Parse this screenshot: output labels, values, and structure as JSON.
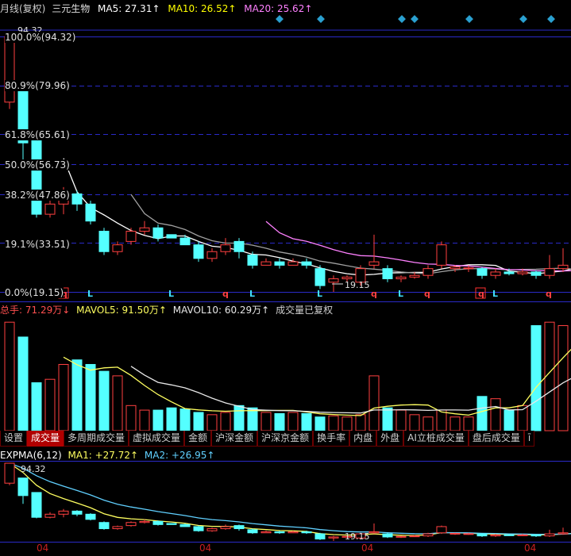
{
  "header": {
    "period": "月线(复权)",
    "stock": "三元生物",
    "ma5_label": "MA5: 27.31↑",
    "ma10_label": "MA10: 26.52↑",
    "ma20_label": "MA20: 25.62↑"
  },
  "price_panel": {
    "high_marker": "94.32",
    "low_marker": "19.15",
    "fib_levels": [
      {
        "label": "100.0%(94.32)",
        "value": 94.32
      },
      {
        "label": "80.9%(79.96)",
        "value": 79.96
      },
      {
        "label": "61.8%(65.61)",
        "value": 65.61
      },
      {
        "label": "50.0%(56.73)",
        "value": 56.73
      },
      {
        "label": "38.2%(47.86)",
        "value": 47.86
      },
      {
        "label": "19.1%(33.51)",
        "value": 33.51
      },
      {
        "label": "0.0%(19.15)",
        "value": 19.15
      }
    ],
    "signals": [
      "q",
      "L",
      "L",
      "q",
      "L",
      "L",
      "q",
      "L",
      "q",
      "q",
      "L",
      "q"
    ],
    "colors": {
      "up": "#ff4040",
      "down": "#54ffff",
      "ma5": "#ffffff",
      "ma10": "#ffff00",
      "ma20": "#ff80ff",
      "grid": "#2a2ac8",
      "diamond": "#2aa0d0"
    }
  },
  "volume_panel": {
    "total_label": "总手: 71.29万↓",
    "mavol5_label": "MAVOL5: 91.50万↑",
    "mavol10_label": "MAVOL10: 60.29万↑",
    "note": "成交量已复权"
  },
  "tabs": [
    "设置",
    "成交量",
    "多周期成交量",
    "虚拟成交量",
    "金额",
    "沪深金额",
    "沪深京金额",
    "换手率",
    "内盘",
    "外盘",
    "AI立桩成交量",
    "盘后成交量",
    "ī"
  ],
  "active_tab": "成交量",
  "expma_panel": {
    "title_label": "EXPMA(6,12)",
    "ma1_label": "MA1: +27.72↑",
    "ma2_label": "MA2: +26.95↑",
    "high_marker": "94.32",
    "low_marker": "19.15"
  },
  "x_axis": [
    "04",
    "04",
    "04",
    "04"
  ],
  "chart_data": {
    "type": "candlestick",
    "ylim": [
      19.15,
      94.32
    ],
    "candles": [
      {
        "o": 75,
        "c": 94.3,
        "h": 94.32,
        "l": 73
      },
      {
        "o": 80,
        "c": 63,
        "h": 80,
        "l": 55
      },
      {
        "o": 66,
        "c": 42,
        "h": 66,
        "l": 41
      },
      {
        "o": 42,
        "c": 45,
        "h": 47,
        "l": 41
      },
      {
        "o": 45,
        "c": 48,
        "h": 50,
        "l": 42
      },
      {
        "o": 48,
        "c": 45,
        "h": 49,
        "l": 43
      },
      {
        "o": 45,
        "c": 40,
        "h": 46,
        "l": 39
      },
      {
        "o": 37,
        "c": 31,
        "h": 38,
        "l": 30
      },
      {
        "o": 31,
        "c": 33,
        "h": 34,
        "l": 30
      },
      {
        "o": 34,
        "c": 37,
        "h": 38,
        "l": 33
      },
      {
        "o": 37,
        "c": 38,
        "h": 40,
        "l": 36
      },
      {
        "o": 38,
        "c": 35,
        "h": 39,
        "l": 34
      },
      {
        "o": 36,
        "c": 35,
        "h": 36,
        "l": 35
      },
      {
        "o": 35,
        "c": 33,
        "h": 36,
        "l": 33
      },
      {
        "o": 33,
        "c": 29,
        "h": 34,
        "l": 28
      },
      {
        "o": 29,
        "c": 31,
        "h": 32,
        "l": 28
      },
      {
        "o": 31,
        "c": 33,
        "h": 35,
        "l": 30
      },
      {
        "o": 34,
        "c": 31,
        "h": 35,
        "l": 29
      },
      {
        "o": 30,
        "c": 27,
        "h": 31,
        "l": 26
      },
      {
        "o": 27,
        "c": 28,
        "h": 29,
        "l": 27
      },
      {
        "o": 28,
        "c": 27,
        "h": 29,
        "l": 26
      },
      {
        "o": 27,
        "c": 28,
        "h": 29,
        "l": 27
      },
      {
        "o": 28,
        "c": 27,
        "h": 29,
        "l": 26
      },
      {
        "o": 26,
        "c": 21,
        "h": 27,
        "l": 20
      },
      {
        "o": 22,
        "c": 23,
        "h": 24,
        "l": 19.15
      },
      {
        "o": 23,
        "c": 23.5,
        "h": 24,
        "l": 22
      },
      {
        "o": 22,
        "c": 26,
        "h": 27,
        "l": 21
      },
      {
        "o": 27,
        "c": 28,
        "h": 36,
        "l": 26
      },
      {
        "o": 26,
        "c": 23,
        "h": 27,
        "l": 22
      },
      {
        "o": 23,
        "c": 23.5,
        "h": 24,
        "l": 22
      },
      {
        "o": 23.5,
        "c": 24,
        "h": 25,
        "l": 23
      },
      {
        "o": 24,
        "c": 26,
        "h": 27,
        "l": 23
      },
      {
        "o": 27,
        "c": 33,
        "h": 34,
        "l": 26
      },
      {
        "o": 26,
        "c": 26.5,
        "h": 27,
        "l": 25
      },
      {
        "o": 26,
        "c": 26.2,
        "h": 27,
        "l": 25
      },
      {
        "o": 26,
        "c": 24,
        "h": 26.5,
        "l": 23
      },
      {
        "o": 24,
        "c": 25,
        "h": 26,
        "l": 23
      },
      {
        "o": 25,
        "c": 24.5,
        "h": 26,
        "l": 24
      },
      {
        "o": 24.5,
        "c": 25,
        "h": 26,
        "l": 24
      },
      {
        "o": 25,
        "c": 24,
        "h": 25.5,
        "l": 23
      },
      {
        "o": 24,
        "c": 26,
        "h": 30,
        "l": 23
      },
      {
        "o": 26,
        "c": 27,
        "h": 32,
        "l": 25
      },
      {
        "o": 27,
        "c": 29,
        "h": 32,
        "l": 26
      },
      {
        "o": 29,
        "c": 31,
        "h": 38,
        "l": 28
      }
    ],
    "volumes": [
      95,
      82,
      42,
      45,
      58,
      62,
      58,
      52,
      48,
      22,
      18,
      18,
      20,
      19,
      16,
      14,
      16,
      22,
      20,
      16,
      15,
      16,
      15,
      12,
      13,
      12,
      14,
      48,
      20,
      18,
      14,
      12,
      18,
      12,
      12,
      30,
      28,
      18,
      22,
      92,
      95,
      92,
      80,
      80
    ]
  }
}
